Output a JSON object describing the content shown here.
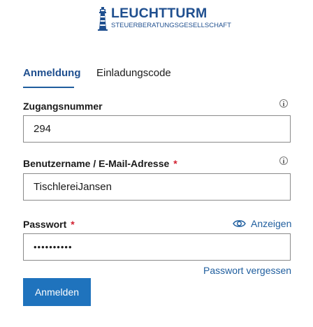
{
  "logo": {
    "brand": "LEUCHTTURM",
    "subtitle": "STEUERBERATUNGSGESELLSCHAFT"
  },
  "tabs": [
    {
      "label": "Anmeldung"
    },
    {
      "label": "Einladungscode"
    }
  ],
  "form": {
    "access_number": {
      "label": "Zugangsnummer",
      "value": "294"
    },
    "username": {
      "label": "Benutzername / E-Mail-Adresse",
      "required_marker": "*",
      "value": "TischlereiJansen"
    },
    "password": {
      "label": "Passwort",
      "required_marker": "*",
      "value": "••••••••••",
      "show_label": "Anzeigen"
    },
    "forgot_link": "Passwort vergessen",
    "submit_label": "Anmelden"
  },
  "colors": {
    "brand_blue": "#1f4f8f",
    "link_blue": "#1f5e9e",
    "button_blue": "#1f73bd",
    "required_red": "#d22030"
  },
  "icons": [
    "lighthouse-icon",
    "info-icon",
    "eye-icon"
  ]
}
